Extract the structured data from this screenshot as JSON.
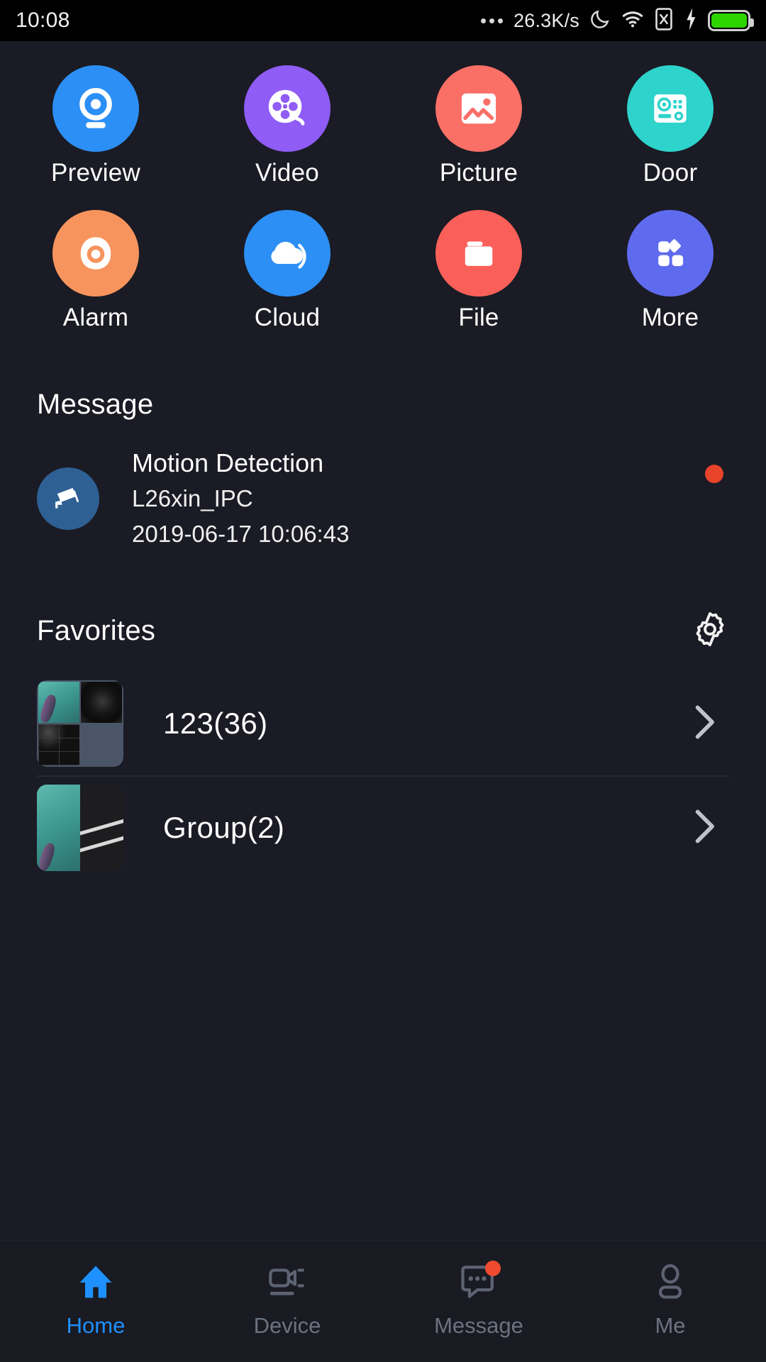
{
  "status_bar": {
    "time": "10:08",
    "network_speed": "26.3K/s",
    "icons": [
      "more-dots-icon",
      "moon-icon",
      "wifi-icon",
      "sim-x-icon",
      "charging-bolt-icon",
      "battery-icon"
    ],
    "battery_color": "#2DD400"
  },
  "shortcuts": {
    "rows": [
      [
        {
          "label": "Preview",
          "icon": "webcam-icon",
          "color": "#2C8FF5"
        },
        {
          "label": "Video",
          "icon": "film-reel-icon",
          "color": "#8F5CF6"
        },
        {
          "label": "Picture",
          "icon": "image-icon",
          "color": "#FA6F66"
        },
        {
          "label": "Door",
          "icon": "doorbell-panel-icon",
          "color": "#2ED3CB"
        }
      ],
      [
        {
          "label": "Alarm",
          "icon": "siren-icon",
          "color": "#F7945E"
        },
        {
          "label": "Cloud",
          "icon": "cloud-icon",
          "color": "#2C8FF5"
        },
        {
          "label": "File",
          "icon": "folder-icon",
          "color": "#FA6059"
        },
        {
          "label": "More",
          "icon": "grid-apps-icon",
          "color": "#5E6BEE"
        }
      ]
    ]
  },
  "message": {
    "section_title": "Message",
    "items": [
      {
        "icon": "cctv-camera-icon",
        "title": "Motion Detection",
        "device": "L26xin_IPC",
        "timestamp": "2019-06-17 10:06:43",
        "unread": true,
        "unread_color": "#E8432B"
      }
    ]
  },
  "favorites": {
    "section_title": "Favorites",
    "settings_icon": "gear-icon",
    "items": [
      {
        "label": "123(36)",
        "thumbnail": "camera-grid-thumbnail",
        "chevron": "chevron-right-icon"
      },
      {
        "label": "Group(2)",
        "thumbnail": "camera-pair-thumbnail",
        "chevron": "chevron-right-icon"
      }
    ]
  },
  "tabbar": {
    "active_color": "#1E90FF",
    "inactive_color": "#6C7280",
    "tabs": [
      {
        "label": "Home",
        "icon": "home-icon",
        "active": true,
        "badge": false
      },
      {
        "label": "Device",
        "icon": "video-camera-icon",
        "active": false,
        "badge": false
      },
      {
        "label": "Message",
        "icon": "chat-bubble-icon",
        "active": false,
        "badge": true
      },
      {
        "label": "Me",
        "icon": "person-icon",
        "active": false,
        "badge": false
      }
    ]
  }
}
